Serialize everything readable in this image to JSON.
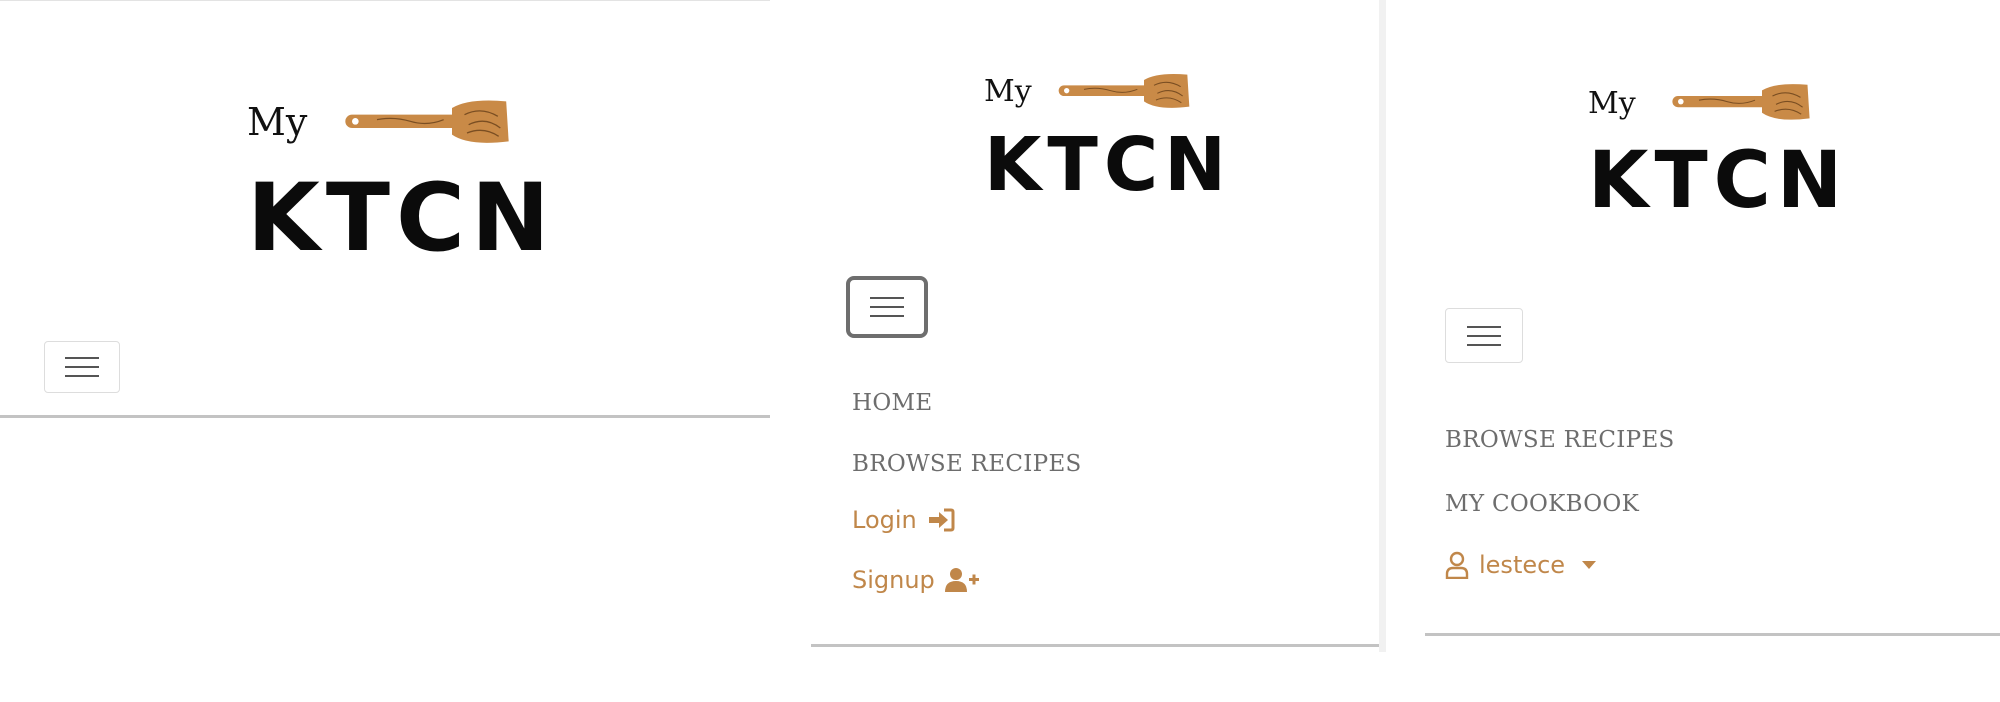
{
  "panels": [
    {
      "logo": {
        "my": "My",
        "ktcn": "KTCN"
      },
      "nav": []
    },
    {
      "logo": {
        "my": "My",
        "ktcn": "KTCN"
      },
      "nav": {
        "home": "HOME",
        "browse": "BROWSE RECIPES",
        "login": "Login",
        "signup": "Signup"
      }
    },
    {
      "logo": {
        "my": "My",
        "ktcn": "KTCN"
      },
      "nav": {
        "browse": "BROWSE RECIPES",
        "cookbook": "MY COOKBOOK",
        "user": "lestece"
      }
    }
  ],
  "colors": {
    "accent": "#c0874a",
    "spoon": "#c98a47",
    "nav_text": "#6d6d6d"
  },
  "icons": {
    "toggler": "hamburger-icon",
    "login": "sign-in-icon",
    "signup": "user-plus-icon",
    "user": "user-outline-icon",
    "dropdown": "caret-down-icon"
  }
}
